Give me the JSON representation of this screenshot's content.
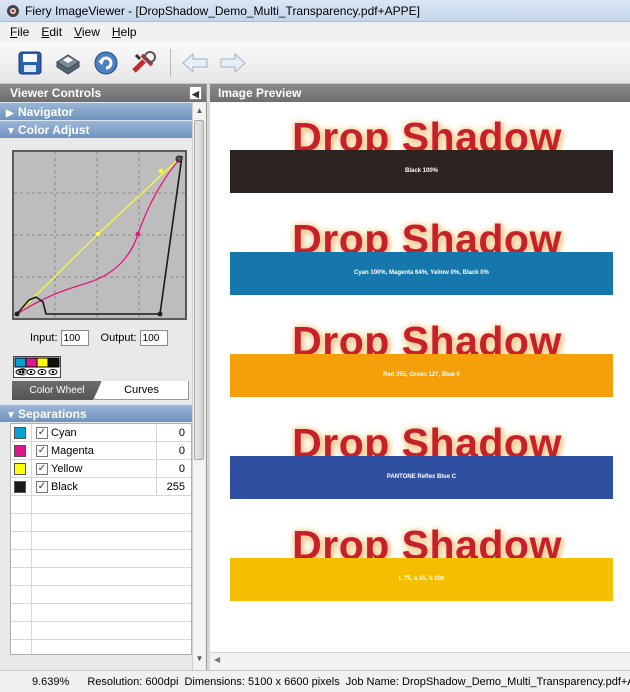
{
  "window": {
    "title": "Fiery ImageViewer - [DropShadow_Demo_Multi_Transparency.pdf+APPE]"
  },
  "menu": {
    "items": [
      "File",
      "Edit",
      "View",
      "Help"
    ]
  },
  "toolbar": {
    "icons": [
      "save-icon",
      "print-icon",
      "refresh-icon",
      "tools-icon",
      "back-arrow-icon",
      "forward-arrow-icon"
    ]
  },
  "left_panel": {
    "header": "Viewer Controls",
    "navigator": "Navigator",
    "color_adjust": "Color Adjust",
    "input_label": "Input:",
    "input_value": "100",
    "output_label": "Output:",
    "output_value": "100",
    "tabs": {
      "color_wheel": "Color Wheel",
      "curves": "Curves"
    },
    "separations_title": "Separations",
    "separations": [
      {
        "name": "Cyan",
        "value": "0",
        "color": "#00a0d8"
      },
      {
        "name": "Magenta",
        "value": "0",
        "color": "#e0168c"
      },
      {
        "name": "Yellow",
        "value": "0",
        "color": "#ffff00"
      },
      {
        "name": "Black",
        "value": "255",
        "color": "#1a1a1a"
      }
    ]
  },
  "right_panel": {
    "header": "Image Preview",
    "blocks": [
      {
        "heading": "Drop Shadow",
        "label": "Black 100%",
        "color": "#2b2420"
      },
      {
        "heading": "Drop Shadow",
        "label": "Cyan 100%, Magenta 64%, Yellow 0%, Black 0%",
        "color": "#1677ad"
      },
      {
        "heading": "Drop Shadow",
        "label": "Red 255, Green 127, Blue 0",
        "color": "#f5a00a"
      },
      {
        "heading": "Drop Shadow",
        "label": "PANTONE Reflex Blue C",
        "color": "#2f4fa0"
      },
      {
        "heading": "Drop Shadow",
        "label": "L 75, a 15, b 100",
        "color": "#f5bf00"
      }
    ]
  },
  "status": {
    "zoom": "9.639%",
    "resolution": "Resolution: 600dpi",
    "dimensions": "Dimensions: 5100 x 6600 pixels",
    "job": "Job Name: DropShadow_Demo_Multi_Transparency.pdf+APPE"
  }
}
